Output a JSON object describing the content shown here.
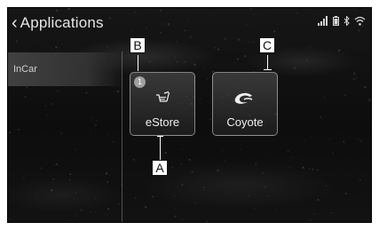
{
  "header": {
    "back_icon": "chevron-left-icon",
    "title": "Applications"
  },
  "status_icons": [
    "signal-bars-icon",
    "battery-icon",
    "bluetooth-icon",
    "wifi-icon"
  ],
  "sidebar": {
    "items": [
      {
        "label": "InCar"
      }
    ]
  },
  "apps": [
    {
      "label": "eStore",
      "icon": "cart-icon",
      "badge": "1"
    },
    {
      "label": "Coyote",
      "icon": "coyote-logo-icon"
    }
  ],
  "callouts": {
    "a": "A",
    "b": "B",
    "c": "C"
  }
}
